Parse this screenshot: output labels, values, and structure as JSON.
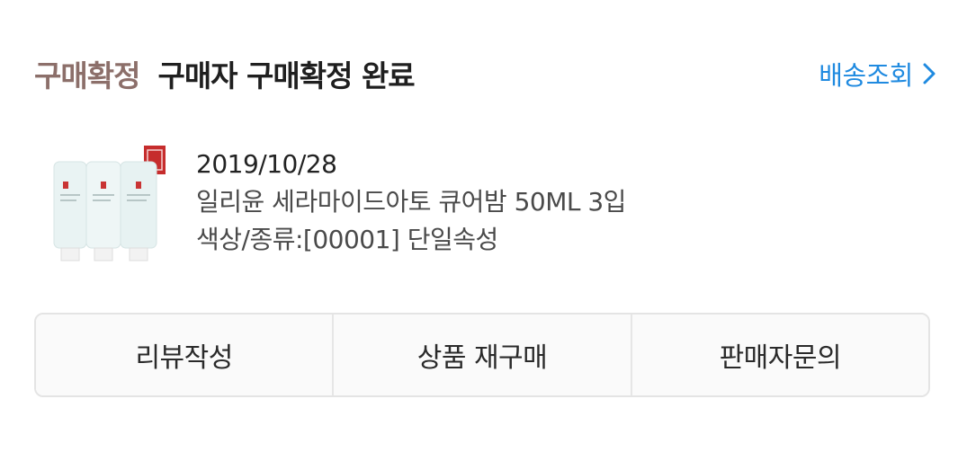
{
  "header": {
    "status_label": "구매확정",
    "status_title": "구매자 구매확정 완료",
    "track_link_label": "배송조회",
    "link_color": "#1f8ae0",
    "status_color": "#8c6f6a"
  },
  "product": {
    "date": "2019/10/28",
    "name": "일리윤 세라마이드아토 큐어밤 50ML 3입",
    "option": "색상/종류:[00001] 단일속성",
    "thumbnail_icon": "product-tubes-image"
  },
  "actions": {
    "review_label": "리뷰작성",
    "rebuy_label": "상품 재구매",
    "seller_inquiry_label": "판매자문의"
  }
}
